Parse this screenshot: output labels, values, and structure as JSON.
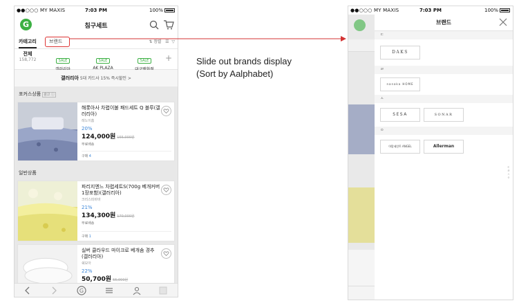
{
  "left_screen": {
    "status": {
      "carrier": "●●○○○ MY MAXIS",
      "time": "7:03 PM",
      "battery": "100%"
    },
    "header_title": "침구세트",
    "tabs": {
      "category": "카테고리",
      "brand": "브랜드",
      "sort": "정렬"
    },
    "category_all": {
      "label": "전체",
      "count": "158,772"
    },
    "brand_chips": [
      {
        "sale": "SALE",
        "name": "갤러리아"
      },
      {
        "sale": "SALE",
        "name": "AK PLAZA"
      },
      {
        "sale": "SALE",
        "name": "대구백화점"
      }
    ],
    "promo": {
      "brand": "갤러리아",
      "text": "5대 카드사 15% 즉시할인",
      "chev": ">"
    },
    "focus_section": "포커스상품",
    "ad_label": "광고 ⓘ",
    "general_section": "일반상품",
    "products": [
      {
        "name": "해롯아사 차렵이불 패드세트 Q 블루(갤러리아)",
        "brand": "레노이홈",
        "discount": "20%",
        "price": "124,000원",
        "original": "155,000원",
        "shipping": "무료배송",
        "buy_label": "구매",
        "buy_count": "4"
      },
      {
        "name": "파리지엔느 차렵세트S(700g 베개커버1장포함)(갤러리아)",
        "brand": "크리스피바바",
        "discount": "21%",
        "price": "134,300원",
        "original": "170,000원",
        "shipping": "무료배송",
        "buy_label": "구매",
        "buy_count": "1"
      },
      {
        "name": "실버 클라우드 마이크로 베개솜 경추 (갤러리아)",
        "brand": "쉐모아",
        "discount": "22%",
        "price": "50,700원",
        "original": "65,000원"
      }
    ]
  },
  "right_screen": {
    "status": {
      "carrier": "●●○○○ MY MAXIS",
      "time": "7:03 PM",
      "battery": "100%"
    },
    "panel_title": "브랜드",
    "groups": [
      {
        "letter": "ㄷ",
        "brands": [
          "DAKS"
        ]
      },
      {
        "letter": "ㄹ",
        "brands": [
          "nanaka HOME"
        ]
      },
      {
        "letter": "ㅅ",
        "brands": [
          "SESA",
          "SONAR"
        ]
      },
      {
        "letter": "ㅇ",
        "brands": [
          "아망세인트 ANGEL",
          "Allerman"
        ]
      }
    ],
    "index": [
      "ㄷ",
      "ㄹ",
      "ㅅ",
      "ㅇ"
    ]
  },
  "annotation": "Slide out brands display (Sort by Aalphabet)",
  "colors": {
    "accent_green": "#3cb043",
    "highlight_red": "#d33333",
    "discount_blue": "#3a85d8"
  }
}
